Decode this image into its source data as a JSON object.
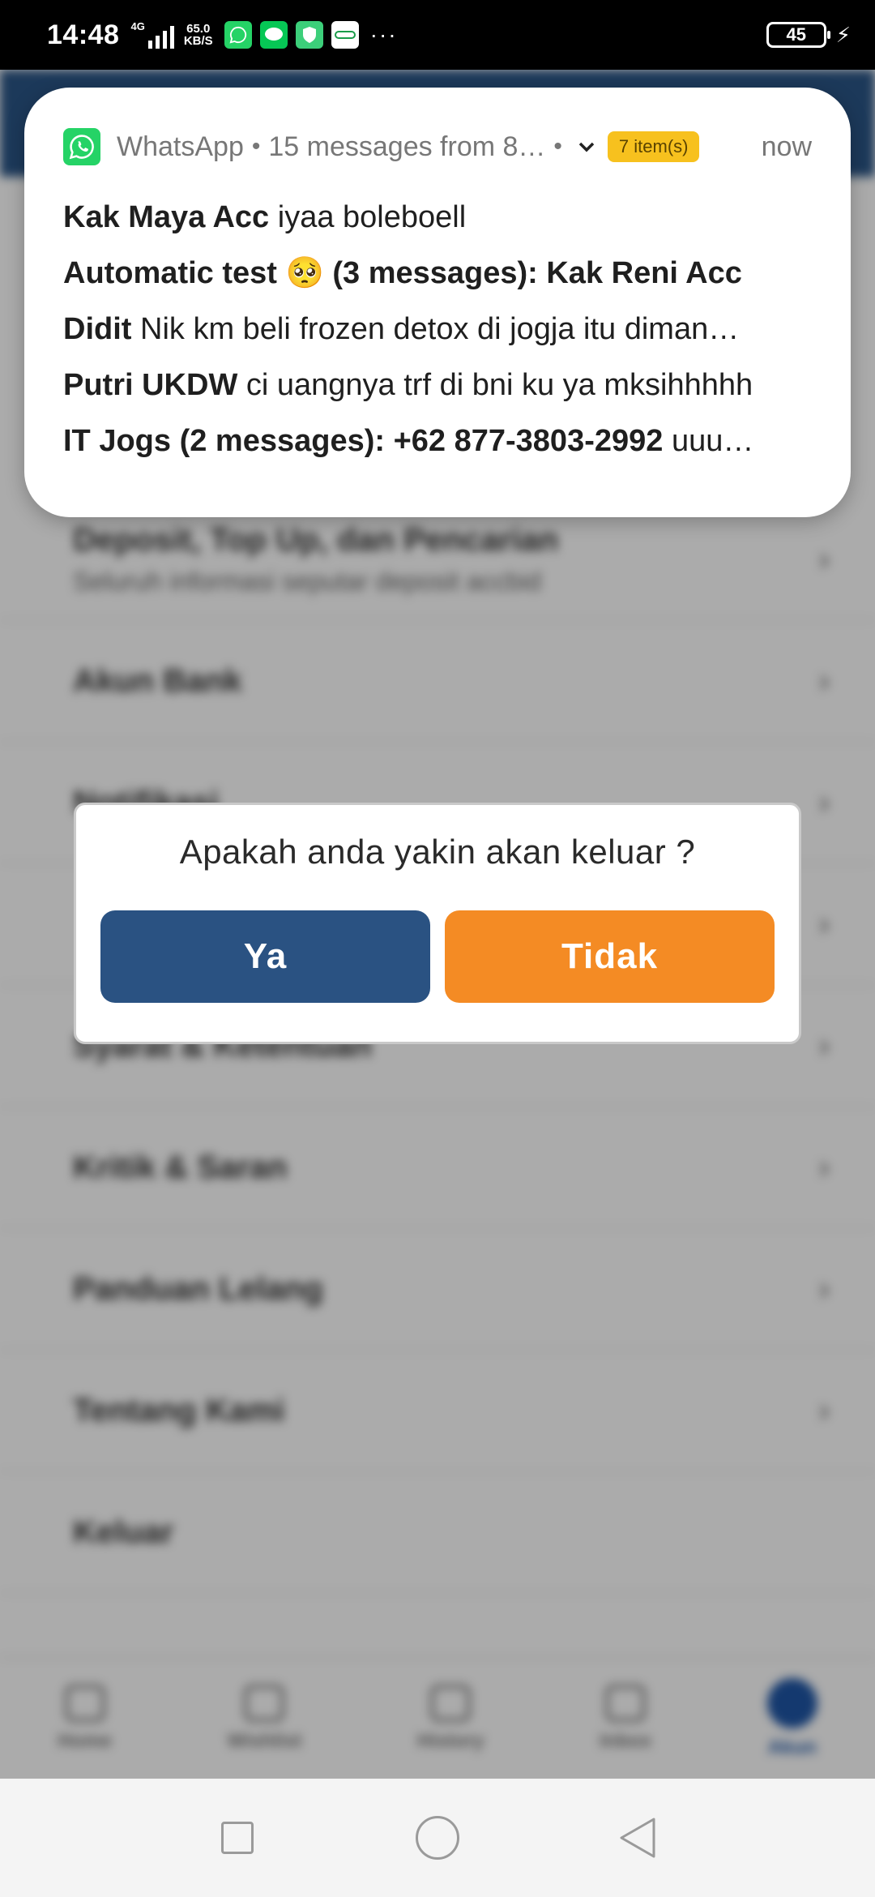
{
  "status_bar": {
    "time": "14:48",
    "network_type": "4G",
    "speed_value": "65.0",
    "speed_unit": "KB/S",
    "app_icons": [
      "whatsapp-icon",
      "line-icon",
      "shield-icon",
      "grab-icon"
    ],
    "more": "···",
    "battery": "45"
  },
  "notification": {
    "app_name": "WhatsApp",
    "separator": "•",
    "summary": "15 messages from 8…",
    "badge": "7 item(s)",
    "time": "now",
    "messages": [
      {
        "sender": "Kak Maya Acc",
        "text": "iyaa boleboell"
      },
      {
        "sender": "Automatic test 🥺 (3 messages): Kak Reni Acc",
        "text": ""
      },
      {
        "sender": "Didit",
        "text": "Nik km beli frozen detox di jogja itu diman…"
      },
      {
        "sender": "Putri UKDW",
        "text": "ci uangnya trf di bni ku ya mksihhhhh"
      },
      {
        "sender": "IT Jogs (2 messages): +62 877-3803-2992",
        "text": "uuu…"
      }
    ]
  },
  "background": {
    "menu_items": [
      {
        "label": "Deposit, Top Up, dan Pencarian",
        "sub": "Seluruh informasi seputar deposit accbid"
      },
      {
        "label": "Akun Bank",
        "sub": ""
      },
      {
        "label": "Notifikasi",
        "sub": ""
      },
      {
        "label": "",
        "sub": ""
      },
      {
        "label": "Syarat & Ketentuan",
        "sub": ""
      },
      {
        "label": "Kritik & Saran",
        "sub": ""
      },
      {
        "label": "Panduan Lelang",
        "sub": ""
      },
      {
        "label": "Tentang Kami",
        "sub": ""
      },
      {
        "label": "Keluar",
        "sub": ""
      }
    ],
    "chevron": "›",
    "bottom_nav": [
      "Home",
      "Wishlist",
      "History",
      "Inbox",
      "Akun"
    ]
  },
  "dialog": {
    "question": "Apakah anda yakin akan keluar ?",
    "yes_label": "Ya",
    "no_label": "Tidak"
  },
  "colors": {
    "header": "#2b5687",
    "yes_button": "#2a5282",
    "no_button": "#f48b24",
    "whatsapp": "#25d366",
    "badge": "#f7c11e"
  }
}
